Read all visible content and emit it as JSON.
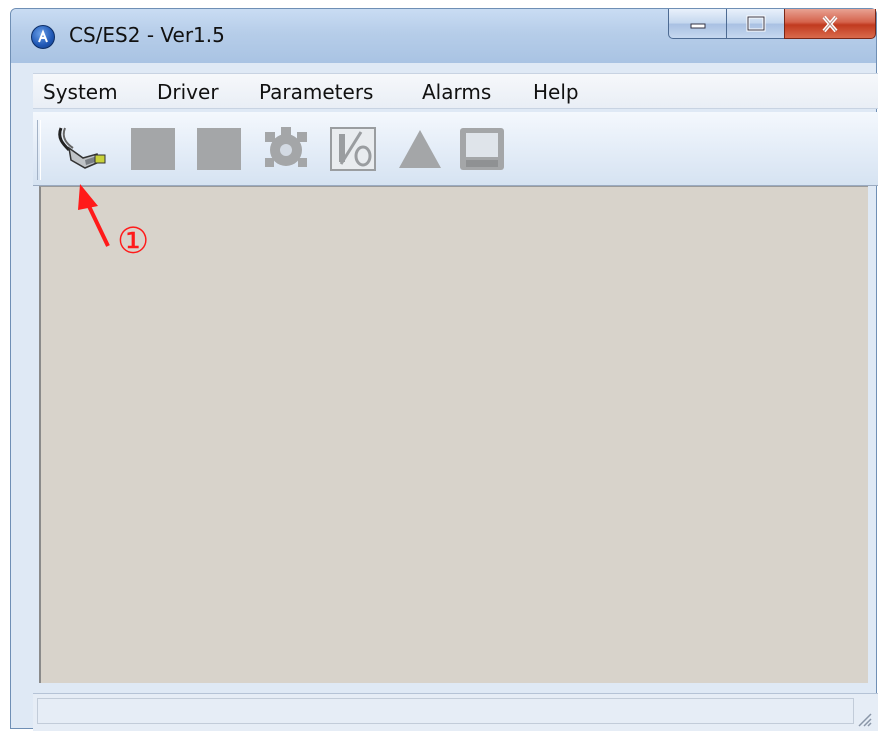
{
  "window": {
    "title": "CS/ES2 - Ver1.5"
  },
  "menubar": {
    "items": [
      "System",
      "Driver",
      "Parameters",
      "Alarms",
      "Help"
    ]
  },
  "toolbar": {
    "buttons": [
      {
        "icon": "connect-cable-icon",
        "enabled": true
      },
      {
        "icon": "gray-square-icon",
        "enabled": false
      },
      {
        "icon": "gray-square-icon",
        "enabled": false
      },
      {
        "icon": "gear-icon",
        "enabled": false
      },
      {
        "icon": "io-icon",
        "enabled": false
      },
      {
        "icon": "warning-triangle-icon",
        "enabled": false
      },
      {
        "icon": "save-icon",
        "enabled": false
      }
    ]
  },
  "annotation": {
    "marker": "①",
    "color": "#ff1a1a"
  }
}
